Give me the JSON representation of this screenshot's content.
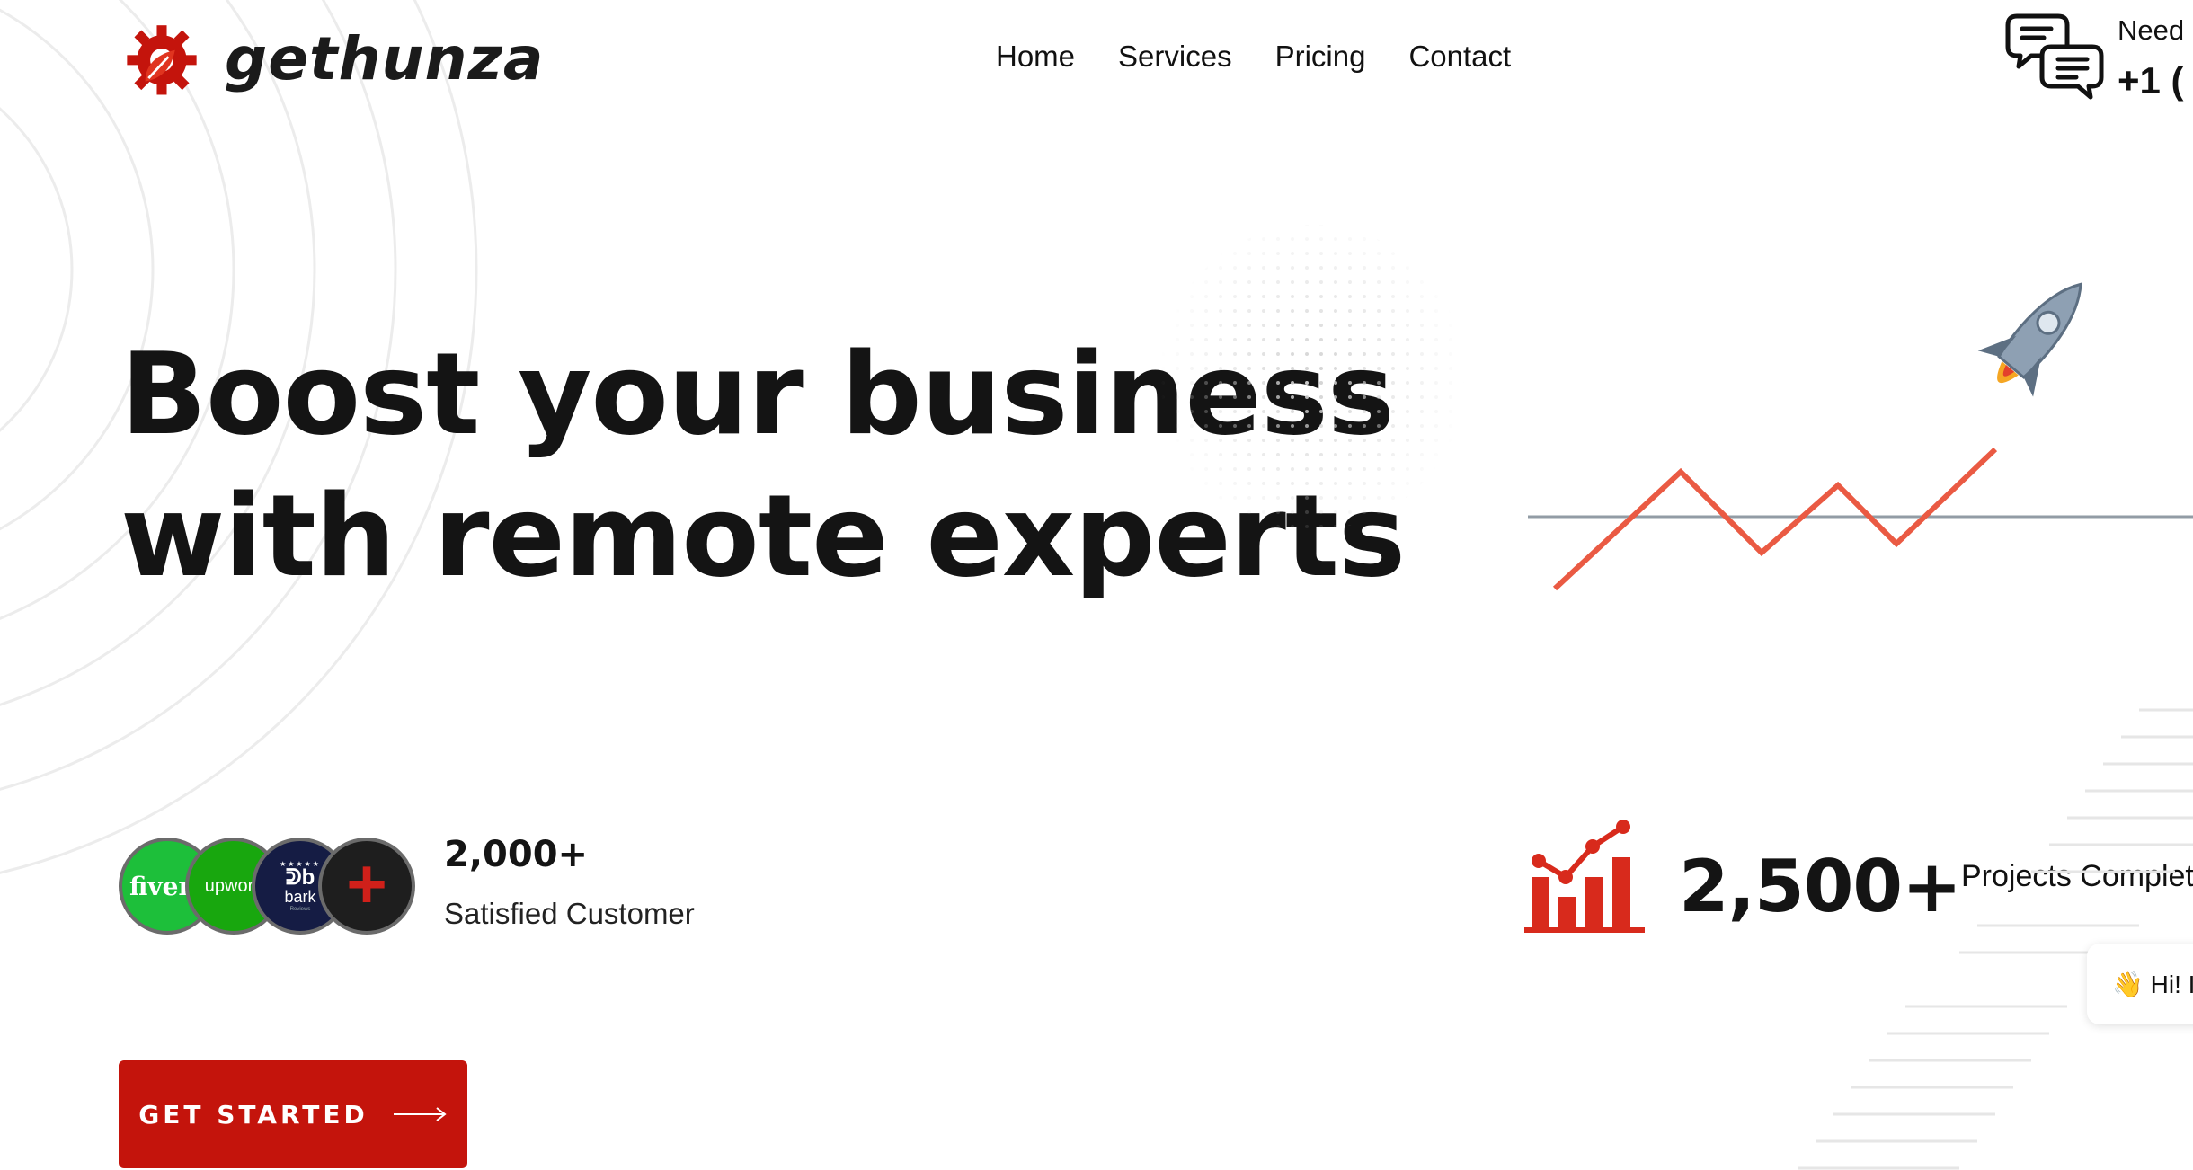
{
  "brand": {
    "name": "gethunza",
    "accent": "#c4140c"
  },
  "nav": {
    "items": [
      "Home",
      "Services",
      "Pricing",
      "Contact"
    ]
  },
  "help": {
    "label": "Need",
    "phone": "+1 ("
  },
  "hero": {
    "title_line1": "Boost your business",
    "title_line2": "with remote experts"
  },
  "badges": [
    {
      "name": "fiverr",
      "text": "fiverr"
    },
    {
      "name": "upwork",
      "text": "upwork"
    },
    {
      "name": "bark",
      "logo": "ᕲb",
      "text": "bark",
      "small": "Reviews"
    },
    {
      "name": "more",
      "text": "+"
    }
  ],
  "customers": {
    "count": "2,000+",
    "label": "Satisfied Customer"
  },
  "projects": {
    "count": "2,500+",
    "label": "Projects Completed"
  },
  "chat": {
    "text": "👋 Hi! I"
  },
  "cta": {
    "label": "GET STARTED"
  },
  "icons": [
    "gear-leaf-logo-icon",
    "chat-bubbles-icon",
    "rocket-icon",
    "bar-chart-growth-icon",
    "arrow-right-icon"
  ]
}
